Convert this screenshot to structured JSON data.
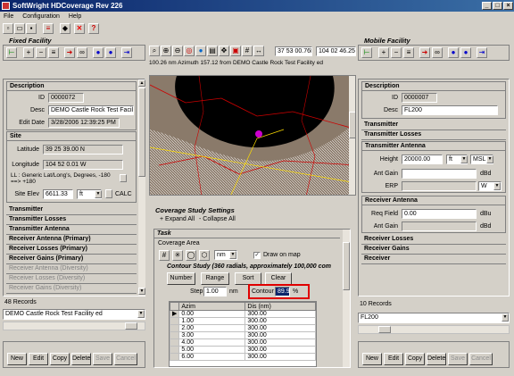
{
  "app": {
    "title": "SoftWright HDCoverage Rev 226"
  },
  "menu": [
    "File",
    "Configuration",
    "Help"
  ],
  "status": {
    "coords_lat": "37 53 00.76N",
    "coords_lon": "104 02 46.25W",
    "map_info": "100.26 nm Azimuth 157.12 from DEMO Castle Rock Test Facility ed"
  },
  "fixed": {
    "title": "Fixed Facility",
    "description_hdr": "Description",
    "id_label": "ID",
    "id": "0000072",
    "desc_label": "Desc",
    "desc": "DEMO Castle Rock Test Facilit",
    "editdate_label": "Edit Date",
    "editdate": "3/28/2006 12:39:25 PM",
    "site_hdr": "Site",
    "lat_label": "Latitude",
    "lat": "39 25 39.00 N",
    "lon_label": "Longitude",
    "lon": "104 52 0.01 W",
    "ll_note": "LL : Generic Lat/Long's, Degrees, -180 ==> +180",
    "elev_label": "Site Elev",
    "elev": "6611.33",
    "elev_unit": "ft",
    "calc_label": "CALC",
    "sections": [
      "Transmitter",
      "Transmitter Losses",
      "Transmitter Antenna",
      "Receiver Antenna (Primary)",
      "Receiver Losses (Primary)",
      "Receiver Gains (Primary)"
    ],
    "grey_sections": [
      "Receiver Antenna (Diversity)",
      "Receiver Losses (Diversity)",
      "Receiver Gains (Diversity)"
    ],
    "records": "48 Records",
    "selected": "DEMO Castle Rock Test Facility ed",
    "buttons": [
      "New",
      "Edit",
      "Copy",
      "Delete",
      "Save",
      "Cancel"
    ]
  },
  "mobile": {
    "title": "Mobile Facility",
    "description_hdr": "Description",
    "id_label": "ID",
    "id": "0000007",
    "desc_label": "Desc",
    "desc": "FL200",
    "sections": [
      "Transmitter",
      "Transmitter Losses"
    ],
    "tx_ant_hdr": "Transmitter Antenna",
    "height_label": "Height",
    "height": "20000.00",
    "height_unit": "ft",
    "height_ref": "MSL",
    "antgain_label": "Ant Gain",
    "antgain_unit": "dBd",
    "erp_label": "ERP",
    "erp_unit": "W",
    "rx_ant_hdr": "Receiver Antenna",
    "reqfield_label": "Req Field",
    "reqfield": "0.00",
    "reqfield_unit": "dBu",
    "rx_antgain_label": "Ant Gain",
    "rx_antgain_unit": "dBd",
    "sections2": [
      "Receiver Losses",
      "Receiver Gains",
      "Receiver"
    ],
    "records": "10 Records",
    "selected": "FL200",
    "buttons": [
      "New",
      "Edit",
      "Copy",
      "Delete",
      "Save",
      "Cancel"
    ]
  },
  "coverage": {
    "title": "Coverage Study Settings",
    "expand_all": "+ Expand All",
    "collapse_all": "- Collapse All",
    "task_label": "Task",
    "area_label": "Coverage Area",
    "unit": "nm",
    "draw_on_map": "Draw on map",
    "contour_title": "Contour Study (360 radials, approximately 100,000 com",
    "btn_number": "Number",
    "btn_range": "Range",
    "btn_sort": "Sort",
    "btn_clear": "Clear",
    "step_label": "Step",
    "step": "1.00",
    "step_unit": "nm",
    "contour_label": "Contour",
    "contour": "89.9",
    "contour_unit": "%",
    "col_azim": "Azim",
    "col_dis": "Dis (nm)",
    "rows": [
      [
        "0.00",
        "300.00"
      ],
      [
        "1.00",
        "300.00"
      ],
      [
        "2.00",
        "300.00"
      ],
      [
        "3.00",
        "300.00"
      ],
      [
        "4.00",
        "300.00"
      ],
      [
        "5.00",
        "300.00"
      ],
      [
        "6.00",
        "300.00"
      ]
    ]
  },
  "colors": {
    "accent_red": "#e00000",
    "title_blue": "#0a246a"
  }
}
